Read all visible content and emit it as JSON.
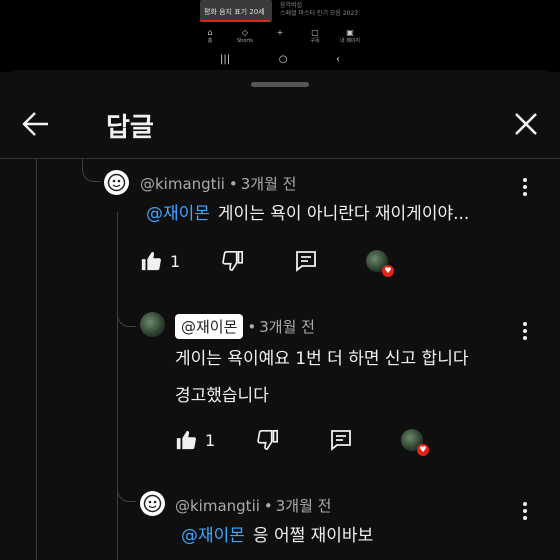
{
  "video_strip": {
    "thumb_text": "평화 음지 표기 20세",
    "side_text_1": "음악비섭",
    "side_text_2": "스페셜 마스터 인기 모음 2023"
  },
  "mini_nav": [
    {
      "icon": "⌂",
      "label": "홈"
    },
    {
      "icon": "◇",
      "label": "Shorts"
    },
    {
      "icon": "+",
      "label": ""
    },
    {
      "icon": "▢",
      "label": "구독"
    },
    {
      "icon": "▣",
      "label": "내 페이지"
    }
  ],
  "system_nav": {
    "recents": "|||",
    "home": "○",
    "back": "‹"
  },
  "header": {
    "title": "답글"
  },
  "comments": [
    {
      "author": "@kimangtii",
      "sep": "•",
      "time": "3개월 전",
      "mention": "@재이몬",
      "text": "게이는 욕이 아니란다 재이게이야...",
      "likes": "1"
    },
    {
      "author": "@재이몬",
      "sep": "•",
      "time": "3개월 전",
      "lines": [
        "게이는 욕이예요 1번 더 하면 신고 합니다",
        "경고했습니다"
      ],
      "likes": "1"
    },
    {
      "author": "@kimangtii",
      "sep": "•",
      "time": "3개월 전",
      "mention": "@재이몬",
      "text": "응 어쩔 재이바보"
    }
  ],
  "colors": {
    "background": "#0f0f0f",
    "mention": "#3ea6ff",
    "heart": "#e62117",
    "meta": "#aaaaaa"
  }
}
